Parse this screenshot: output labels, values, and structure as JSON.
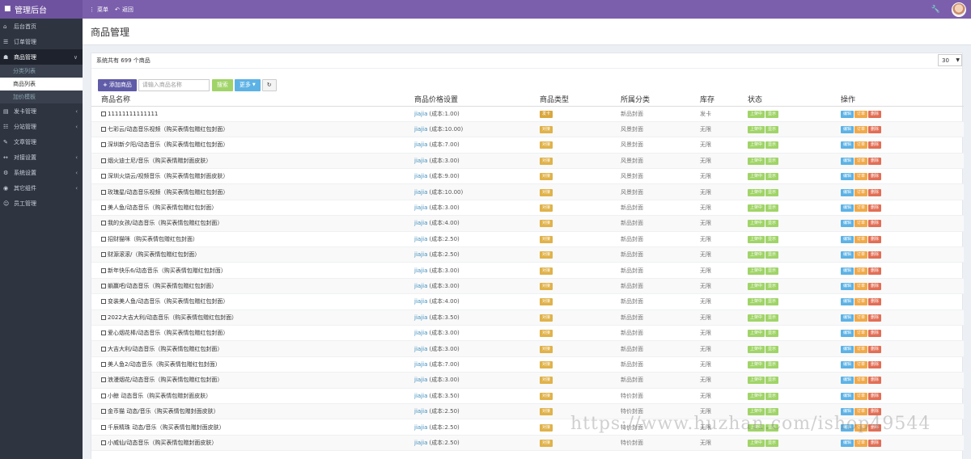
{
  "app": {
    "title": "管理后台"
  },
  "topnav": {
    "menu_label": "菜单",
    "back_label": "返回"
  },
  "sidebar": {
    "items": [
      {
        "label": "后台首页",
        "icon": "home-icon",
        "chevron": false
      },
      {
        "label": "订单管理",
        "icon": "list-icon",
        "chevron": false
      },
      {
        "label": "商品管理",
        "icon": "cart-icon",
        "chevron": true,
        "active": true
      }
    ],
    "sub_items": [
      {
        "label": "分类列表"
      },
      {
        "label": "商品列表",
        "selected": true
      },
      {
        "label": "加价模板"
      }
    ],
    "items_after": [
      {
        "label": "发卡管理",
        "icon": "card-icon",
        "chevron": true
      },
      {
        "label": "分站管理",
        "icon": "site-icon",
        "chevron": true
      },
      {
        "label": "文章管理",
        "icon": "article-icon",
        "chevron": false
      },
      {
        "label": "对接设置",
        "icon": "link-icon",
        "chevron": true
      },
      {
        "label": "系统设置",
        "icon": "gear-icon",
        "chevron": true
      },
      {
        "label": "其它组件",
        "icon": "plug-icon",
        "chevron": true
      },
      {
        "label": "员工管理",
        "icon": "user-icon",
        "chevron": false
      }
    ]
  },
  "page": {
    "title": "商品管理"
  },
  "panel": {
    "summary": "系统共有 699 个商品",
    "page_size": "30"
  },
  "toolbar": {
    "add_label": "添加商品",
    "search_placeholder": "请输入商品名称",
    "search_label": "搜索",
    "more_label": "更多"
  },
  "table": {
    "headers": [
      "商品名称",
      "商品价格设置",
      "商品类型",
      "所属分类",
      "库存",
      "状态",
      "操作"
    ],
    "status_labels": [
      "上架中",
      "显示"
    ],
    "action_labels": [
      "编辑",
      "订单",
      "删除"
    ],
    "rows": [
      {
        "name": "11111111111111",
        "price_name": "jiajia",
        "price_cost": "(成本:1.00)",
        "type": "发卡",
        "category": "新品封面",
        "stock": "发卡"
      },
      {
        "name": "七彩云/动态音乐视频（购买表情包赠红包封面）",
        "price_name": "jiajia",
        "price_cost": "(成本:10.00)",
        "type": "对接",
        "category": "风景封面",
        "stock": "无限"
      },
      {
        "name": "深圳新夕阳/动态音乐（购买表情包赠红包封面）",
        "price_name": "jiajia",
        "price_cost": "(成本:7.00)",
        "type": "对接",
        "category": "风景封面",
        "stock": "无限"
      },
      {
        "name": "烟火迪士尼/音乐（购买表情赠封面皮肤）",
        "price_name": "jiajia",
        "price_cost": "(成本:3.00)",
        "type": "对接",
        "category": "风景封面",
        "stock": "无限"
      },
      {
        "name": "深圳火烧云/视频音乐（购买表情包赠封面皮肤）",
        "price_name": "jiajia",
        "price_cost": "(成本:9.00)",
        "type": "对接",
        "category": "风景封面",
        "stock": "无限"
      },
      {
        "name": "玫瑰星/动态音乐视频（购买表情包赠红包封面）",
        "price_name": "jiajia",
        "price_cost": "(成本:10.00)",
        "type": "对接",
        "category": "风景封面",
        "stock": "无限"
      },
      {
        "name": "美人鱼/动态音乐（购买表情包赠红包封面）",
        "price_name": "jiajia",
        "price_cost": "(成本:3.00)",
        "type": "对接",
        "category": "新品封面",
        "stock": "无限"
      },
      {
        "name": "我的女孩/动态音乐（购买表情包赠红包封面）",
        "price_name": "jiajia",
        "price_cost": "(成本:4.00)",
        "type": "对接",
        "category": "新品封面",
        "stock": "无限"
      },
      {
        "name": "招财猫咪（购买表情包赠红包封面）",
        "price_name": "jiajia",
        "price_cost": "(成本:2.50)",
        "type": "对接",
        "category": "新品封面",
        "stock": "无限"
      },
      {
        "name": "财源滚滚/（购买表情包赠红包封面）",
        "price_name": "jiajia",
        "price_cost": "(成本:2.50)",
        "type": "对接",
        "category": "新品封面",
        "stock": "无限"
      },
      {
        "name": "新年快乐6/动态音乐（购买表情包赠红包封面）",
        "price_name": "jiajia",
        "price_cost": "(成本:3.00)",
        "type": "对接",
        "category": "新品封面",
        "stock": "无限"
      },
      {
        "name": "躺赢吧/动态音乐（购买表情包赠红包封面）",
        "price_name": "jiajia",
        "price_cost": "(成本:3.00)",
        "type": "对接",
        "category": "新品封面",
        "stock": "无限"
      },
      {
        "name": "变装美人鱼/动态音乐（购买表情包赠红包封面）",
        "price_name": "jiajia",
        "price_cost": "(成本:4.00)",
        "type": "对接",
        "category": "新品封面",
        "stock": "无限"
      },
      {
        "name": "2022大吉大利/动态音乐（购买表情包赠红包封面）",
        "price_name": "jiajia",
        "price_cost": "(成本:3.50)",
        "type": "对接",
        "category": "新品封面",
        "stock": "无限"
      },
      {
        "name": "爱心烟花棒/动态音乐（购买表情包赠红包封面）",
        "price_name": "jiajia",
        "price_cost": "(成本:3.00)",
        "type": "对接",
        "category": "新品封面",
        "stock": "无限"
      },
      {
        "name": "大吉大利/动态音乐（购买表情包赠红包封面）",
        "price_name": "jiajia",
        "price_cost": "(成本:3.00)",
        "type": "对接",
        "category": "新品封面",
        "stock": "无限"
      },
      {
        "name": "美人鱼2/动态音乐（购买表情包赠红包封面）",
        "price_name": "jiajia",
        "price_cost": "(成本:7.00)",
        "type": "对接",
        "category": "新品封面",
        "stock": "无限"
      },
      {
        "name": "浪漫烟花/动态音乐（购买表情包赠红包封面）",
        "price_name": "jiajia",
        "price_cost": "(成本:3.00)",
        "type": "对接",
        "category": "新品封面",
        "stock": "无限"
      },
      {
        "name": "小鲸 动态音乐（购买表情包赠封面皮肤）",
        "price_name": "jiajia",
        "price_cost": "(成本:3.50)",
        "type": "对接",
        "category": "特价封面",
        "stock": "无限"
      },
      {
        "name": "金币猫 动态/音乐（购买表情包赠封面皮肤）",
        "price_name": "jiajia",
        "price_cost": "(成本:2.50)",
        "type": "对接",
        "category": "特价封面",
        "stock": "无限"
      },
      {
        "name": "千辰精珠 动态/音乐（购买表情包赠封面皮肤）",
        "price_name": "jiajia",
        "price_cost": "(成本:2.50)",
        "type": "对接",
        "category": "特价封面",
        "stock": "无限"
      },
      {
        "name": "小威仙/动态音乐（购买表情包赠封面皮肤）",
        "price_name": "jiajia",
        "price_cost": "(成本:2.50)",
        "type": "对接",
        "category": "特价封面",
        "stock": "无限"
      }
    ]
  },
  "watermark": "https://www.huzhan.com/ishop49544",
  "colors": {
    "topbar": "#7b5fad",
    "sidebar": "#2f3441",
    "add_button": "#605ca8",
    "search_button": "#a0d468",
    "more_button": "#5db2e5",
    "edit_tag": "#5db2e5",
    "order_tag": "#f0a94a",
    "delete_tag": "#e26e55"
  }
}
